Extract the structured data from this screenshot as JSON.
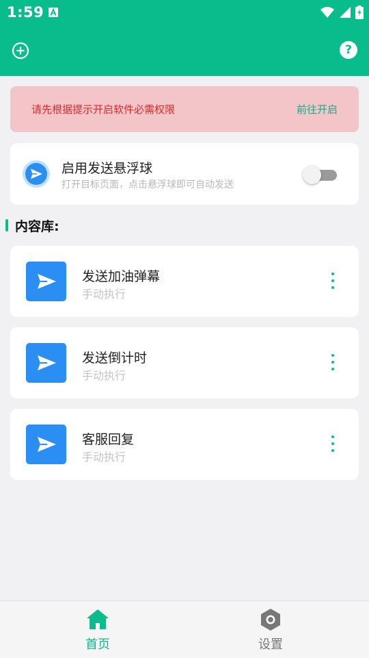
{
  "status_bar": {
    "time": "1:59",
    "icons": [
      "a-notification-icon",
      "wifi-icon",
      "signal-icon",
      "battery-charging-icon"
    ]
  },
  "header": {
    "left_icon": "add-circle-icon",
    "right_icon": "help-icon",
    "help_glyph": "?"
  },
  "banner": {
    "message": "请先根据提示开启软件必需权限",
    "action_label": "前往开启"
  },
  "float_ball": {
    "title": "启用发送悬浮球",
    "subtitle": "打开目标页面，点击悬浮球即可自动发送",
    "enabled": false
  },
  "section": {
    "title": "内容库:"
  },
  "library": [
    {
      "title": "发送加油弹幕",
      "subtitle": "手动执行",
      "icon": "send-icon"
    },
    {
      "title": "发送倒计时",
      "subtitle": "手动执行",
      "icon": "send-icon"
    },
    {
      "title": "客服回复",
      "subtitle": "手动执行",
      "icon": "send-icon"
    }
  ],
  "bottom_nav": [
    {
      "label": "首页",
      "icon": "home-icon",
      "active": true
    },
    {
      "label": "设置",
      "icon": "settings-icon",
      "active": false
    }
  ],
  "colors": {
    "accent": "#08bc8c",
    "primary_blue": "#2a8ef3",
    "warning_bg": "#f4c5c8",
    "warning_text": "#e02a2a",
    "inactive": "#777777"
  }
}
